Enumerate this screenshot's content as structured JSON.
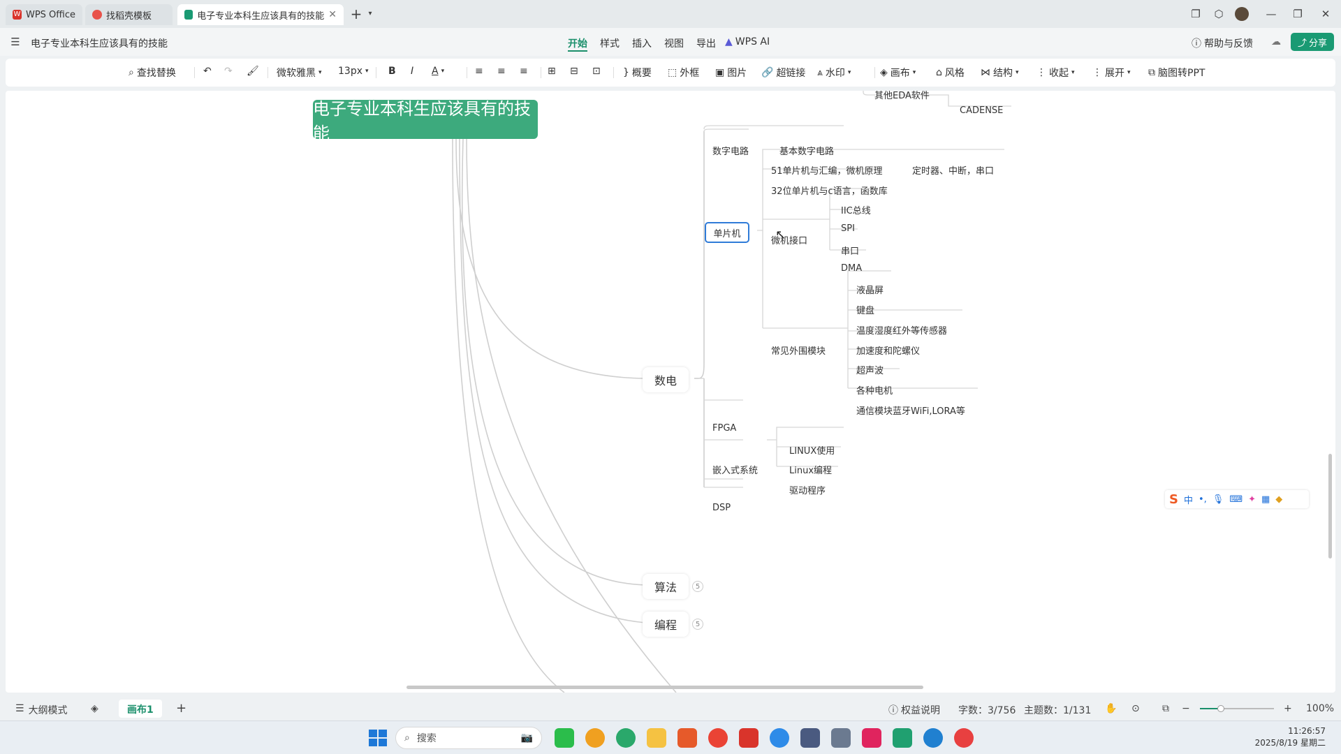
{
  "tabs": [
    {
      "label": "WPS Office"
    },
    {
      "label": "找稻壳模板"
    },
    {
      "label": "电子专业本科生应该具有的技能"
    }
  ],
  "doc_title": "电子专业本科生应该具有的技能",
  "menu": [
    "开始",
    "样式",
    "插入",
    "视图",
    "导出",
    "WPS AI"
  ],
  "help_label": "帮助与反馈",
  "share_label": "分享",
  "toolbar": {
    "find_replace": "查找替换",
    "font": "微软雅黑",
    "font_size": "13px",
    "summary": "概要",
    "outer_frame": "外框",
    "image": "图片",
    "hyperlink": "超链接",
    "watermark": "水印",
    "canvas": "画布",
    "style": "风格",
    "structure": "结构",
    "collapse": "收起",
    "expand": "展开",
    "to_ppt": "脑图转PPT"
  },
  "mindmap": {
    "root": "电子专业本科生应该具有的技能",
    "branch_shudian": "数电",
    "branch_suanfa": "算法",
    "branch_biancheng": "编程",
    "suanfa_count": "5",
    "biancheng_count": "5",
    "other_eda": "其他EDA软件",
    "cadense": "CADENSE",
    "digital_circuit": "数字电路",
    "basic_digital": "基本数字电路",
    "mcu": "单片机",
    "mcu_51": "51单片机与汇编，微机原理",
    "timers": "定时器、中断，串口",
    "mcu_32": "32位单片机与c语言，函数库",
    "micro_interface": "微机接口",
    "iic": "IIC总线",
    "spi": "SPI",
    "serial": "串口",
    "dma": "DMA",
    "peripherals": "常见外围模块",
    "lcd": "液晶屏",
    "keyboard": "键盘",
    "temp_sensor": "温度湿度红外等传感器",
    "accel": "加速度和陀螺仪",
    "ultrasonic": "超声波",
    "motors": "各种电机",
    "comm": "通信模块蓝牙WiFi,LORA等",
    "fpga": "FPGA",
    "embedded": "嵌入式系统",
    "linux_use": "LINUX使用",
    "linux_prog": "Linux编程",
    "driver": "驱动程序",
    "dsp": "DSP"
  },
  "status": {
    "outline_mode": "大纲模式",
    "canvas_tab": "画布1",
    "rights": "权益说明",
    "word_count": "字数：3/756",
    "topic_count": "主题数：1/131",
    "zoom": "100%"
  },
  "taskbar": {
    "search": "搜索",
    "time": "11:26:57",
    "date": "2025/8/19 星期二"
  },
  "ime": {
    "label": "中"
  },
  "colors": {
    "accent": "#1a9a73",
    "root": "#3daa7d",
    "selection": "#2f7bd8"
  }
}
